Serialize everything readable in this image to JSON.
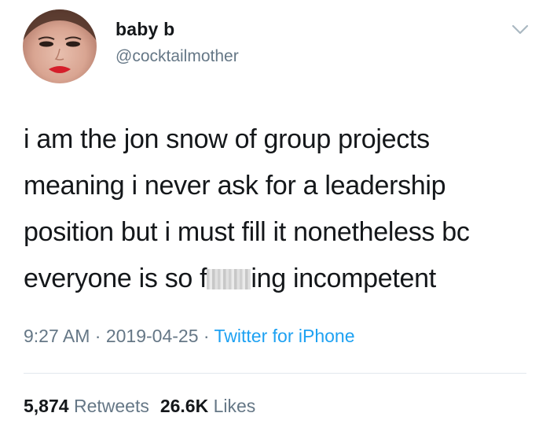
{
  "author": {
    "display_name": "baby b",
    "handle": "@cocktailmother",
    "avatar_icon": "profile-photo"
  },
  "menu": {
    "icon": "chevron-down-icon"
  },
  "tweet": {
    "lines": [
      "i am the jon snow of group projects",
      "meaning i never ask for a leadership",
      "position but i must fill it nonetheless bc"
    ],
    "last_line_before": "everyone is so f",
    "last_line_after": "ing incompetent"
  },
  "meta": {
    "time": "9:27 AM",
    "sep1": " · ",
    "date": "2019-04-25",
    "sep2": " · ",
    "source": "Twitter for iPhone"
  },
  "stats": {
    "retweets_count": "5,874",
    "retweets_label": "Retweets",
    "likes_count": "26.6K",
    "likes_label": "Likes"
  },
  "colors": {
    "text": "#14171a",
    "muted": "#657786",
    "link": "#1da1f2",
    "divider": "#e1e8ed"
  }
}
